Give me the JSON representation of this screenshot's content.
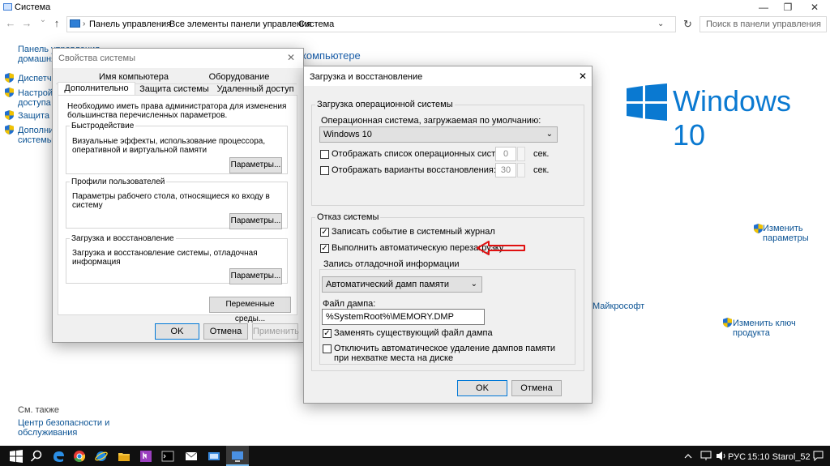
{
  "window": {
    "title": "Система",
    "minimize": "—",
    "maximize": "❐",
    "close": "✕"
  },
  "nav": {
    "back": "←",
    "forward": "→",
    "dropdown": "⌄",
    "up": "↑",
    "breadcrumbs": [
      "Панель управления",
      "Все элементы панели управления",
      "Система"
    ],
    "refresh": "↻",
    "search_placeholder": "Поиск в панели управления"
  },
  "left": {
    "home_line1": "Панель управления —",
    "home_line2": "домашняя страница",
    "links": [
      {
        "label": "Диспетчер"
      },
      {
        "label": "Настройка",
        "label2": "доступа"
      },
      {
        "label": "Защита сист"
      },
      {
        "label": "Дополните",
        "label2": "системы"
      }
    ],
    "see_also": "См. также",
    "security_line1": "Центр безопасности и",
    "security_line2": "обслуживания"
  },
  "main": {
    "heading_tail": "компьютере",
    "brand": "Windows 10",
    "change_settings_1": "Изменить",
    "change_settings_2": "параметры",
    "ms_tail": "Майкрософт",
    "change_key": "Изменить ключ продукта"
  },
  "sysprops": {
    "title": "Свойства системы",
    "close": "✕",
    "tabs_top": [
      "Имя компьютера",
      "Оборудование"
    ],
    "tabs_bottom": [
      "Дополнительно",
      "Защита системы",
      "Удаленный доступ"
    ],
    "admin_note": "Необходимо иметь права администратора для изменения большинства перечисленных параметров.",
    "perf_title": "Быстродействие",
    "perf_desc": "Визуальные эффекты, использование процессора, оперативной и виртуальной памяти",
    "profiles_title": "Профили пользователей",
    "profiles_desc": "Параметры рабочего стола, относящиеся ко входу в систему",
    "startup_title": "Загрузка и восстановление",
    "startup_desc": "Загрузка и восстановление системы, отладочная информация",
    "params_btn": "Параметры...",
    "env_btn": "Переменные среды...",
    "ok": "OK",
    "cancel": "Отмена",
    "apply": "Применить"
  },
  "startup": {
    "title": "Загрузка и восстановление",
    "close": "✕",
    "boot_group": "Загрузка операционной системы",
    "default_os_label": "Операционная система, загружаемая по умолчанию:",
    "default_os": "Windows 10",
    "show_os_list": "Отображать список операционных систем:",
    "show_os_list_checked": false,
    "os_list_time": "0",
    "show_recovery": "Отображать варианты восстановления:",
    "show_recovery_checked": false,
    "recovery_time": "30",
    "sec": "сек.",
    "failure_group": "Отказ системы",
    "write_event": "Записать событие в системный журнал",
    "write_event_checked": true,
    "auto_restart": "Выполнить автоматическую перезагрузку",
    "auto_restart_checked": true,
    "debug_group": "Запись отладочной информации",
    "dump_type": "Автоматический дамп памяти",
    "dump_file_label": "Файл дампа:",
    "dump_file": "%SystemRoot%\\MEMORY.DMP",
    "overwrite": "Заменять существующий файл дампа",
    "overwrite_checked": true,
    "disable_auto_delete": "Отключить автоматическое удаление дампов памяти при нехватке места на диске",
    "disable_auto_delete_checked": false,
    "ok": "OK",
    "cancel": "Отмена"
  },
  "taskbar": {
    "lang": "РУС",
    "clock": "15:10 Starol_52"
  },
  "colors": {
    "accent": "#0078d7",
    "link": "#0b5394",
    "brand": "#0a79d1",
    "arrow": "#e01010"
  }
}
